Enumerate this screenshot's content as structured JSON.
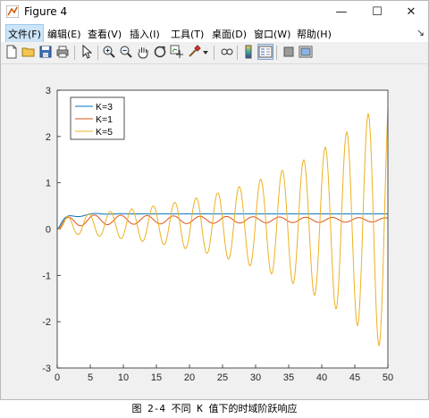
{
  "window": {
    "title": "Figure 4",
    "minimize": "—",
    "maximize": "☐",
    "close": "✕"
  },
  "menu": {
    "items": [
      "文件(F)",
      "编辑(E)",
      "查看(V)",
      "插入(I)",
      "工具(T)",
      "桌面(D)",
      "窗口(W)",
      "帮助(H)"
    ],
    "dock": "↘"
  },
  "toolbar": {
    "buttons": [
      "new-figure",
      "open-file",
      "save",
      "print",
      "pointer",
      "zoom-in",
      "zoom-out",
      "pan",
      "rotate-3d",
      "data-cursor",
      "brush",
      "link",
      "insert-colorbar",
      "insert-legend",
      "hide-plot-tools",
      "show-plot-tools"
    ]
  },
  "caption": "图 2-4 不同 K 值下的时域阶跃响应",
  "colors": {
    "k3": "#0072BD",
    "k1": "#D95319",
    "k5": "#EDB120"
  },
  "chart_data": {
    "type": "line",
    "xlim": [
      0,
      50
    ],
    "ylim": [
      -3,
      3
    ],
    "xticks": [
      0,
      5,
      10,
      15,
      20,
      25,
      30,
      35,
      40,
      45,
      50
    ],
    "yticks": [
      -3,
      -2,
      -1,
      0,
      1,
      2,
      3
    ],
    "legend_position": "top-left",
    "grid": false,
    "series": [
      {
        "name": "K=3",
        "color": "#0072BD",
        "type": "damped",
        "final": 0.33,
        "amp": 0.1,
        "decay": 0.35,
        "period": 4.2,
        "phase": 0.5
      },
      {
        "name": "K=1",
        "color": "#D95319",
        "type": "damped",
        "final": 0.2,
        "amp": 0.12,
        "decay": 0.02,
        "period": 4.0,
        "phase": 0.6
      },
      {
        "name": "K=5",
        "color": "#EDB120",
        "type": "growing",
        "final": 0.1,
        "amp": 0.18,
        "growth": 0.055,
        "period": 3.25,
        "phase": 0.7
      }
    ]
  }
}
